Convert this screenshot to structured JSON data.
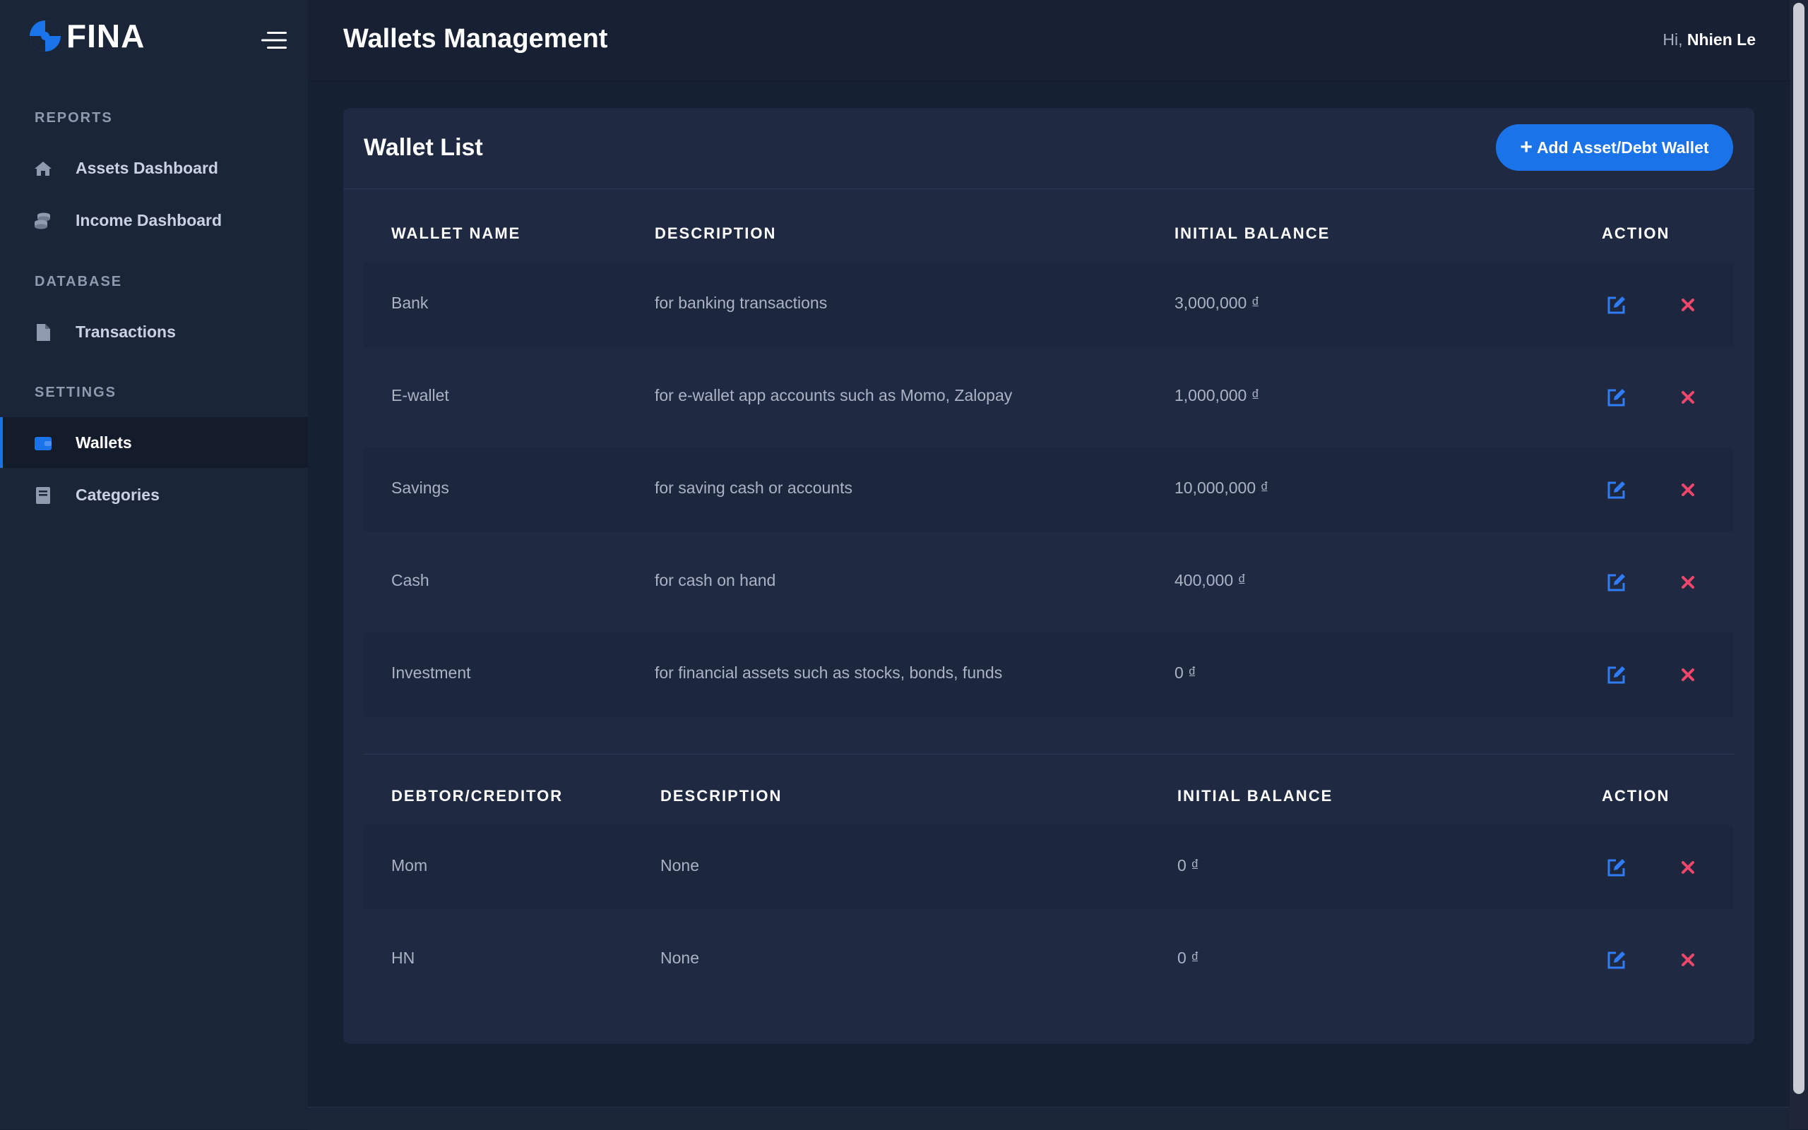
{
  "brand": {
    "name": "FINA",
    "accent": "#1a73e8"
  },
  "header": {
    "title": "Wallets Management",
    "greeting_prefix": "Hi,",
    "user_name": "Nhien Le"
  },
  "sidebar": {
    "sections": [
      {
        "label": "REPORTS",
        "items": [
          {
            "label": "Assets Dashboard",
            "icon": "home-icon"
          },
          {
            "label": "Income Dashboard",
            "icon": "coins-icon"
          }
        ]
      },
      {
        "label": "DATABASE",
        "items": [
          {
            "label": "Transactions",
            "icon": "file-icon"
          }
        ]
      },
      {
        "label": "SETTINGS",
        "items": [
          {
            "label": "Wallets",
            "icon": "wallet-icon",
            "active": true
          },
          {
            "label": "Categories",
            "icon": "book-icon"
          }
        ]
      }
    ]
  },
  "card": {
    "title": "Wallet List",
    "add_button": "Add Asset/Debt Wallet"
  },
  "wallets": {
    "columns": [
      "WALLET NAME",
      "DESCRIPTION",
      "INITIAL BALANCE",
      "ACTION"
    ],
    "rows": [
      {
        "name": "Bank",
        "description": "for banking transactions",
        "balance": "3,000,000 ₫"
      },
      {
        "name": "E-wallet",
        "description": "for e-wallet app accounts such as Momo, Zalopay",
        "balance": "1,000,000 ₫"
      },
      {
        "name": "Savings",
        "description": "for saving cash or accounts",
        "balance": "10,000,000 ₫"
      },
      {
        "name": "Cash",
        "description": "for cash on hand",
        "balance": "400,000 ₫"
      },
      {
        "name": "Investment",
        "description": "for financial assets such as stocks, bonds, funds",
        "balance": "0 ₫"
      }
    ]
  },
  "debts": {
    "columns": [
      "DEBTOR/CREDITOR",
      "DESCRIPTION",
      "INITIAL BALANCE",
      "ACTION"
    ],
    "rows": [
      {
        "name": "Mom",
        "description": "None",
        "balance": "0 ₫"
      },
      {
        "name": "HN",
        "description": "None",
        "balance": "0 ₫"
      }
    ]
  },
  "colors": {
    "edit": "#2f7cf6",
    "delete": "#f0466b"
  }
}
